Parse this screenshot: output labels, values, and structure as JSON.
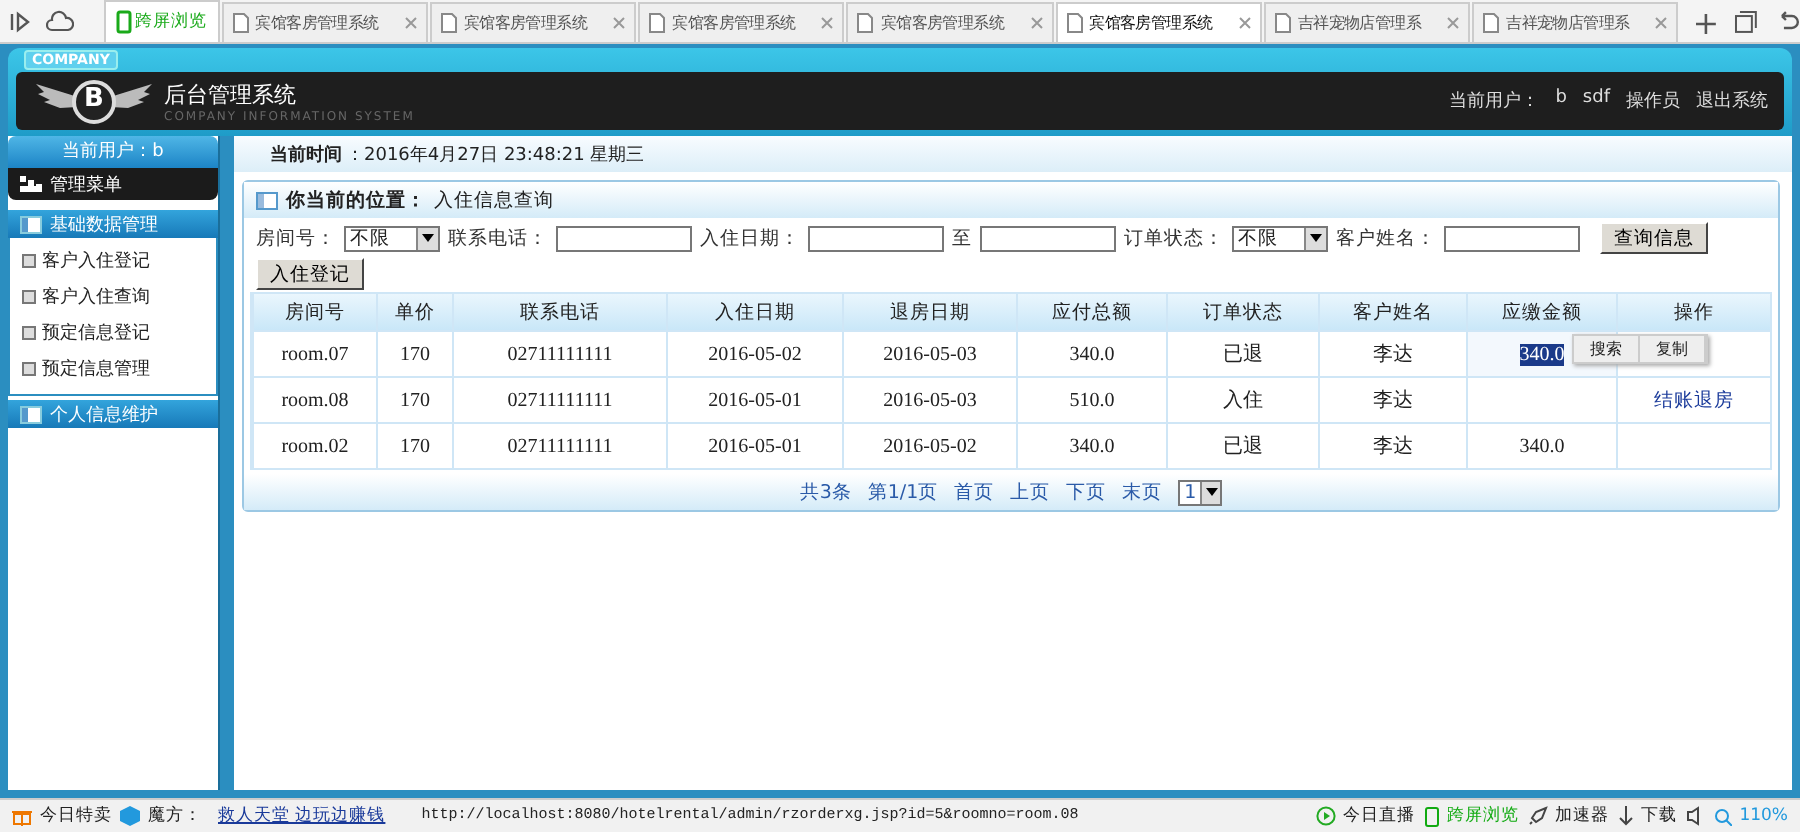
{
  "browser": {
    "quick_tab": "跨屏浏览",
    "tabs": [
      {
        "title": "宾馆客房管理系统",
        "selected": false
      },
      {
        "title": "宾馆客房管理系统",
        "selected": false
      },
      {
        "title": "宾馆客房管理系统",
        "selected": false
      },
      {
        "title": "宾馆客房管理系统",
        "selected": false
      },
      {
        "title": "宾馆客房管理系统",
        "selected": true
      },
      {
        "title": "吉祥宠物店管理系",
        "selected": false
      },
      {
        "title": "吉祥宠物店管理系",
        "selected": false
      }
    ]
  },
  "header": {
    "badge": "COMPANY",
    "logo_mark": "B",
    "title": "后台管理系统",
    "subtitle": "COMPANY INFORMATION SYSTEM",
    "user_label": "当前用户：",
    "user": "b",
    "user_name": "sdf",
    "role": "操作员",
    "logout": "退出系统"
  },
  "sidebar": {
    "current_user": "当前用户：b",
    "menu_title": "管理菜单",
    "sections": [
      {
        "title": "基础数据管理",
        "expanded": true,
        "items": [
          "客户入住登记",
          "客户入住查询",
          "预定信息登记",
          "预定信息管理"
        ]
      },
      {
        "title": "个人信息维护",
        "expanded": false
      }
    ]
  },
  "time_bar": {
    "label": "当前时间",
    "value": "：2016年4月27日  23:48:21  星期三"
  },
  "panel": {
    "location_label": "你当前的位置：",
    "location": "入住信息查询",
    "filters": [
      {
        "label": "房间号：",
        "kind": "select",
        "value": "不限"
      },
      {
        "label": "联系电话：",
        "kind": "text"
      },
      {
        "label": "入住日期：",
        "kind": "text"
      },
      {
        "label": "至",
        "kind": "text"
      },
      {
        "label": "订单状态：",
        "kind": "select",
        "value": "不限"
      },
      {
        "label": "客户姓名：",
        "kind": "text"
      }
    ],
    "search_button": "查询信息",
    "add_button": "入住登记",
    "columns": [
      "房间号",
      "单价",
      "联系电话",
      "入住日期",
      "退房日期",
      "应付总额",
      "订单状态",
      "客户姓名",
      "应缴金额",
      "操作"
    ],
    "rows": [
      {
        "cells": [
          "room.07",
          "170",
          "02711111111",
          "2016-05-02",
          "2016-05-03",
          "340.0",
          "已退",
          "李达",
          "340.0",
          ""
        ],
        "amount_selected": true
      },
      {
        "cells": [
          "room.08",
          "170",
          "02711111111",
          "2016-05-01",
          "2016-05-03",
          "510.0",
          "入住",
          "李达",
          "",
          "结账退房"
        ],
        "amount_selected": false
      },
      {
        "cells": [
          "room.02",
          "170",
          "02711111111",
          "2016-05-01",
          "2016-05-02",
          "340.0",
          "已退",
          "李达",
          "340.0",
          ""
        ],
        "amount_selected": false
      }
    ],
    "context_menu": [
      "搜索",
      "复制"
    ],
    "pager": {
      "summary": "共3条",
      "page": "第1/1页",
      "links": [
        "首页",
        "上页",
        "下页",
        "末页"
      ],
      "select": "1"
    }
  },
  "status_bar": {
    "items": [
      "今日特卖",
      "魔方："
    ],
    "link": "救人天堂 边玩边赚钱",
    "url": "http://localhost:8080/hotelrental/admin/rzorderxg.jsp?id=5&roomno=room.08",
    "right": [
      "今日直播",
      "跨屏浏览",
      "加速器",
      "下载"
    ],
    "zoom": "110%"
  }
}
